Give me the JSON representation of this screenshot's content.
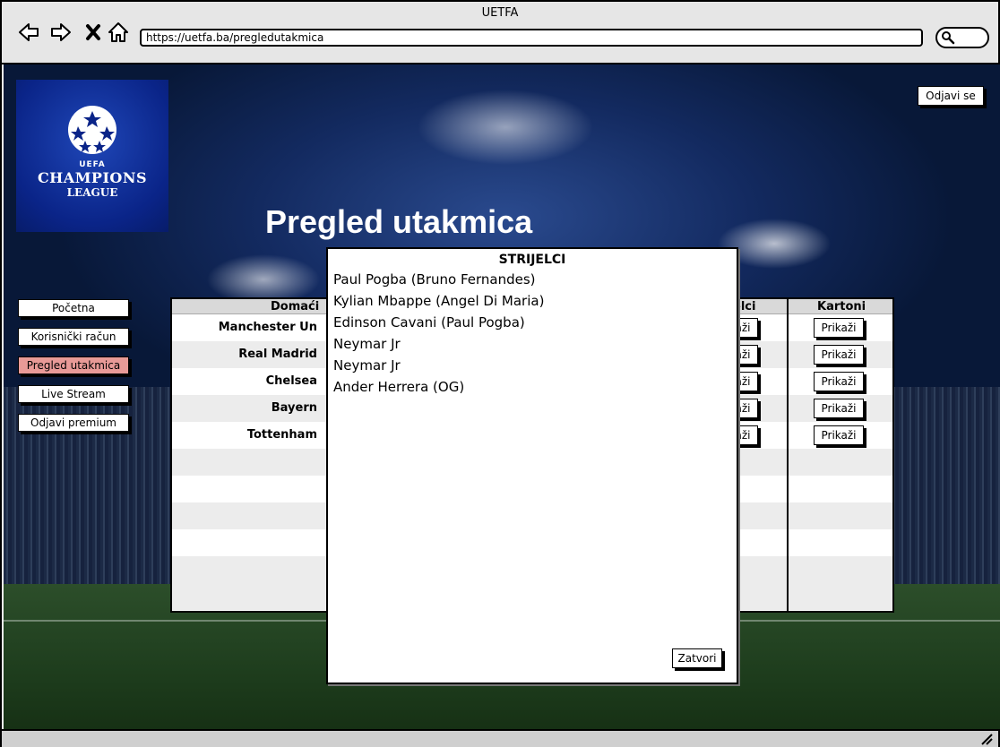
{
  "window": {
    "title": "UETFA"
  },
  "browser": {
    "url": "https://uetfa.ba/pregledutakmica"
  },
  "logo": {
    "line1": "UEFA",
    "line2": "CHAMPIONS",
    "line3": "LEAGUE"
  },
  "header": {
    "logout_label": "Odjavi se",
    "page_title": "Pregled utakmica"
  },
  "sidebar": {
    "items": [
      {
        "label": "Početna"
      },
      {
        "label": "Korisnički račun"
      },
      {
        "label": "Pregled utakmica"
      },
      {
        "label": "Live Stream"
      },
      {
        "label": "Odjavi premium"
      }
    ]
  },
  "table": {
    "columns": {
      "home": "Domaći",
      "scorers": "elci",
      "cards": "Kartoni"
    },
    "rows": [
      {
        "home": "Manchester Un",
        "scorers_btn": "aži",
        "cards_btn": "Prikaži"
      },
      {
        "home": "Real Madrid",
        "scorers_btn": "aži",
        "cards_btn": "Prikaži"
      },
      {
        "home": "Chelsea",
        "scorers_btn": "aži",
        "cards_btn": "Prikaži"
      },
      {
        "home": "Bayern",
        "scorers_btn": "aži",
        "cards_btn": "Prikaži"
      },
      {
        "home": "Tottenham",
        "scorers_btn": "aži",
        "cards_btn": "Prikaži"
      }
    ]
  },
  "modal": {
    "title": "STRIJELCI",
    "scorers": [
      "Paul Pogba (Bruno Fernandes)",
      "Kylian Mbappe (Angel Di Maria)",
      "Edinson Cavani (Paul Pogba)",
      "Neymar Jr",
      "Neymar Jr",
      "Ander Herrera (OG)"
    ],
    "close_label": "Zatvori"
  },
  "colors": {
    "active_nav": "#e89a97",
    "background_blue": "#132a60"
  }
}
